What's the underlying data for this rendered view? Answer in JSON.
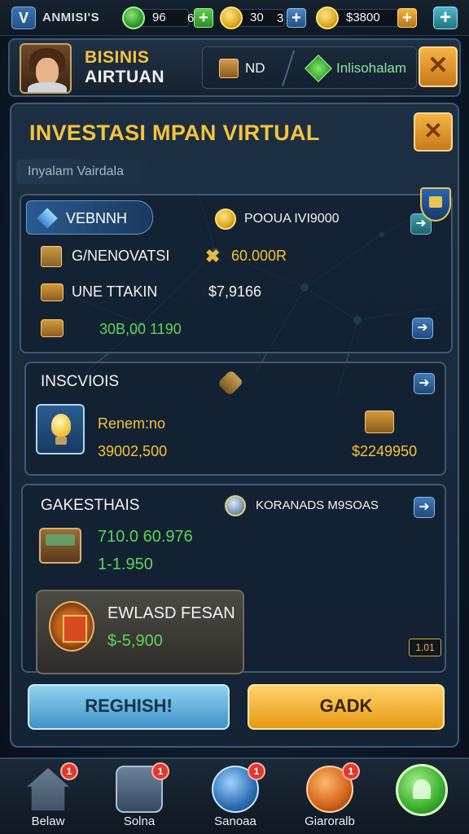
{
  "topbar": {
    "v_label": "V",
    "player_name": "ANMISI'S",
    "res1": {
      "value": "96",
      "extra": "6"
    },
    "res2": {
      "value": "30",
      "extra": "3"
    },
    "res3": {
      "value": "$3800"
    },
    "plus": "+"
  },
  "header": {
    "title_line1": "BISINIS",
    "title_line2": "AIRTUAN",
    "nd_label": "ND",
    "resource_label": "Inlisohalam",
    "close_label": "✕"
  },
  "main": {
    "title": "INVESTASI MPAN VIRTUAL",
    "subtitle": "Inyalam Vairdala",
    "close_label": "✕"
  },
  "card1": {
    "tab_label": "VEBNNH",
    "coin_label": "POOUA IVI9000",
    "row1_label": "G/NENOVATSI",
    "row1_value": "60.000R",
    "row2_label": "UNE TTAKIN",
    "row2_value": "$7,9166",
    "row3_value": "30B,00 1190",
    "arrow": "➜"
  },
  "card2": {
    "title": "INSCVIOIS",
    "item_label": "Renem:no",
    "item_value": "39002,500",
    "right_value": "$2249950",
    "arrow": "➜"
  },
  "card3": {
    "title": "GAKESTHAIS",
    "right_label": "KORANADS M9SOAS",
    "value1": "710.0 60.976",
    "value2": "1-1.950",
    "featured_title": "EWLASD FESAN",
    "featured_value": "$-5,900",
    "ribbon_label": "1.01",
    "arrow": "➜"
  },
  "buttons": {
    "refresh": "REGHISH!",
    "gadk": "GADK"
  },
  "nav": {
    "items": [
      {
        "label": "Belaw",
        "badge": "1"
      },
      {
        "label": "Solna",
        "badge": "1"
      },
      {
        "label": "Sanoaa",
        "badge": "1"
      },
      {
        "label": "Giaroralb",
        "badge": "1"
      }
    ]
  },
  "colors": {
    "accent_gold": "#f5c33b",
    "value_green": "#5fd35a",
    "panel_blue": "#1d2f43"
  }
}
